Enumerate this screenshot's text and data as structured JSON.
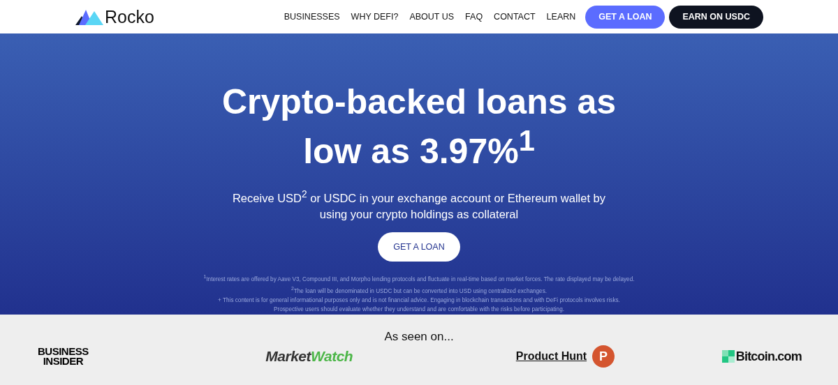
{
  "brand": {
    "name": "Rocko"
  },
  "nav": {
    "links": [
      "BUSINESSES",
      "WHY DEFI?",
      "ABOUT US",
      "FAQ",
      "CONTACT",
      "LEARN"
    ],
    "buttons": [
      {
        "label": "GET A LOAN",
        "kind": "primary"
      },
      {
        "label": "EARN ON USDC",
        "kind": "dark"
      }
    ]
  },
  "hero": {
    "title": "Crypto-backed loans as low as 3.97%$^{1}$",
    "subtitle": "Receive USD$^{2}$ or USDC in your exchange account or Ethereum wallet by using your crypto holdings as collateral",
    "cta": "GET A LOAN",
    "footnotes": [
      "$^{1}$Interest rates are offered by Aave V3, Compound III, and Morpho lending protocols and fluctuate in real-time based on market forces. The rate displayed may be delayed.",
      "$^{2}$The loan will be denominated in USDC but can be converted into USD using centralized exchanges.",
      "+ This content is for general informational purposes only and is not financial advice. Engaging in blockchain transactions and with DeFi protocols involves risks.",
      "Prospective users should evaluate whether they understand and are comfortable with the risks before participating."
    ]
  },
  "press": {
    "heading": "As seen on...",
    "logos": [
      {
        "kind": "stacked",
        "parts": [
          "BUSINESS",
          "INSIDER"
        ]
      },
      {
        "kind": "twotone",
        "parts": [
          "Market",
          "Watch"
        ]
      },
      {
        "kind": "badge",
        "parts": [
          "Product Hunt",
          "P"
        ]
      },
      {
        "kind": "squares",
        "parts": [
          "Bitcoin.com"
        ]
      }
    ]
  }
}
